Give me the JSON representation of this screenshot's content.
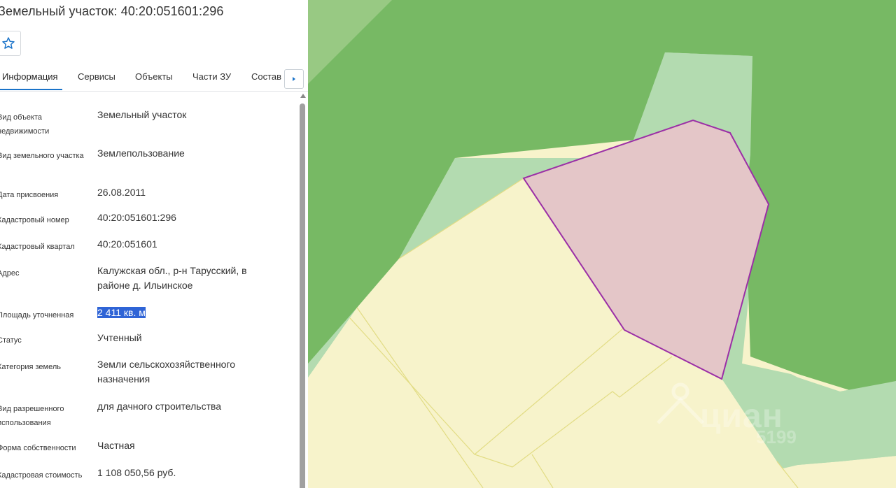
{
  "title": "Земельный участок: 40:20:051601:296",
  "icons": {
    "favorite": "star-icon",
    "next": "chevron-right-icon",
    "pin": "map-pin-icon"
  },
  "tabs": [
    {
      "label": "Информация",
      "active": true
    },
    {
      "label": "Сервисы",
      "active": false
    },
    {
      "label": "Объекты",
      "active": false
    },
    {
      "label": "Части ЗУ",
      "active": false
    },
    {
      "label": "Состав",
      "active": false
    }
  ],
  "fields": [
    {
      "label": "Вид объекта недвижимости",
      "value": "Земельный участок"
    },
    {
      "label": "Вид земельного участка",
      "value": "Землепользование"
    },
    {
      "label": "Дата присвоения",
      "value": "26.08.2011"
    },
    {
      "label": "Кадастровый номер",
      "value": "40:20:051601:296"
    },
    {
      "label": "Кадастровый квартал",
      "value": "40:20:051601"
    },
    {
      "label": "Адрес",
      "value": "Калужская обл., р-н Тарусский, в районе д. Ильинское"
    },
    {
      "label": "Площадь уточненная",
      "value": "2 411 кв. м",
      "selected": true
    },
    {
      "label": "Статус",
      "value": "Учтенный"
    },
    {
      "label": "Категория земель",
      "value": "Земли сельскохозяйственного назначения"
    },
    {
      "label": "Вид разрешенного использования",
      "value": "для дачного строительства"
    },
    {
      "label": "Форма собственности",
      "value": "Частная"
    },
    {
      "label": "Кадастровая стоимость",
      "value": "1 108 050,56 руб."
    }
  ],
  "watermark": {
    "brand": "циан",
    "number": "5199"
  },
  "colors": {
    "accent": "#1a73c9",
    "forest": "#77b964",
    "meadow": "#b3dbb0",
    "parcels": "#f7f3cb",
    "selected_parcel_fill": "#e4c6c8",
    "selected_parcel_stroke": "#9b2fa6",
    "selection": "#2f64d6"
  }
}
